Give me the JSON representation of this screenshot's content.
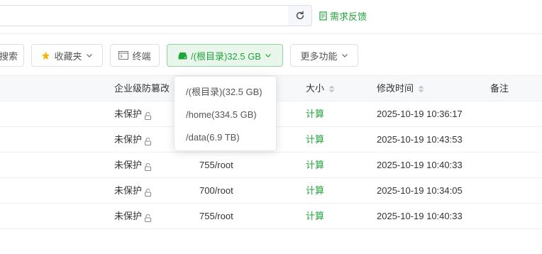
{
  "header": {
    "feedback_label": "需求反馈"
  },
  "toolbar": {
    "search_label": "搜索",
    "favorites_label": "收藏夹",
    "terminal_label": "终端",
    "disk_label": "/(根目录)32.5 GB",
    "more_label": "更多功能"
  },
  "disk_menu": {
    "items": [
      {
        "label": "/(根目录)(32.5 GB)"
      },
      {
        "label": "/home(334.5 GB)"
      },
      {
        "label": "/data(6.9 TB)"
      }
    ]
  },
  "table": {
    "columns": {
      "protect": "企业级防篡改",
      "size": "大小",
      "mtime": "修改时间",
      "note": "备注"
    },
    "rows": [
      {
        "protect": "未保护",
        "perm": "",
        "size": "计算",
        "mtime": "2025-10-19 10:36:17"
      },
      {
        "protect": "未保护",
        "perm": "",
        "size": "计算",
        "mtime": "2025-10-19 10:43:53"
      },
      {
        "protect": "未保护",
        "perm": "755/root",
        "size": "计算",
        "mtime": "2025-10-19 10:40:33"
      },
      {
        "protect": "未保护",
        "perm": "700/root",
        "size": "计算",
        "mtime": "2025-10-19 10:34:05"
      },
      {
        "protect": "未保护",
        "perm": "755/root",
        "size": "计算",
        "mtime": "2025-10-19 10:40:33"
      }
    ]
  },
  "colors": {
    "accent": "#20a53a",
    "border": "#dcdfe6"
  }
}
